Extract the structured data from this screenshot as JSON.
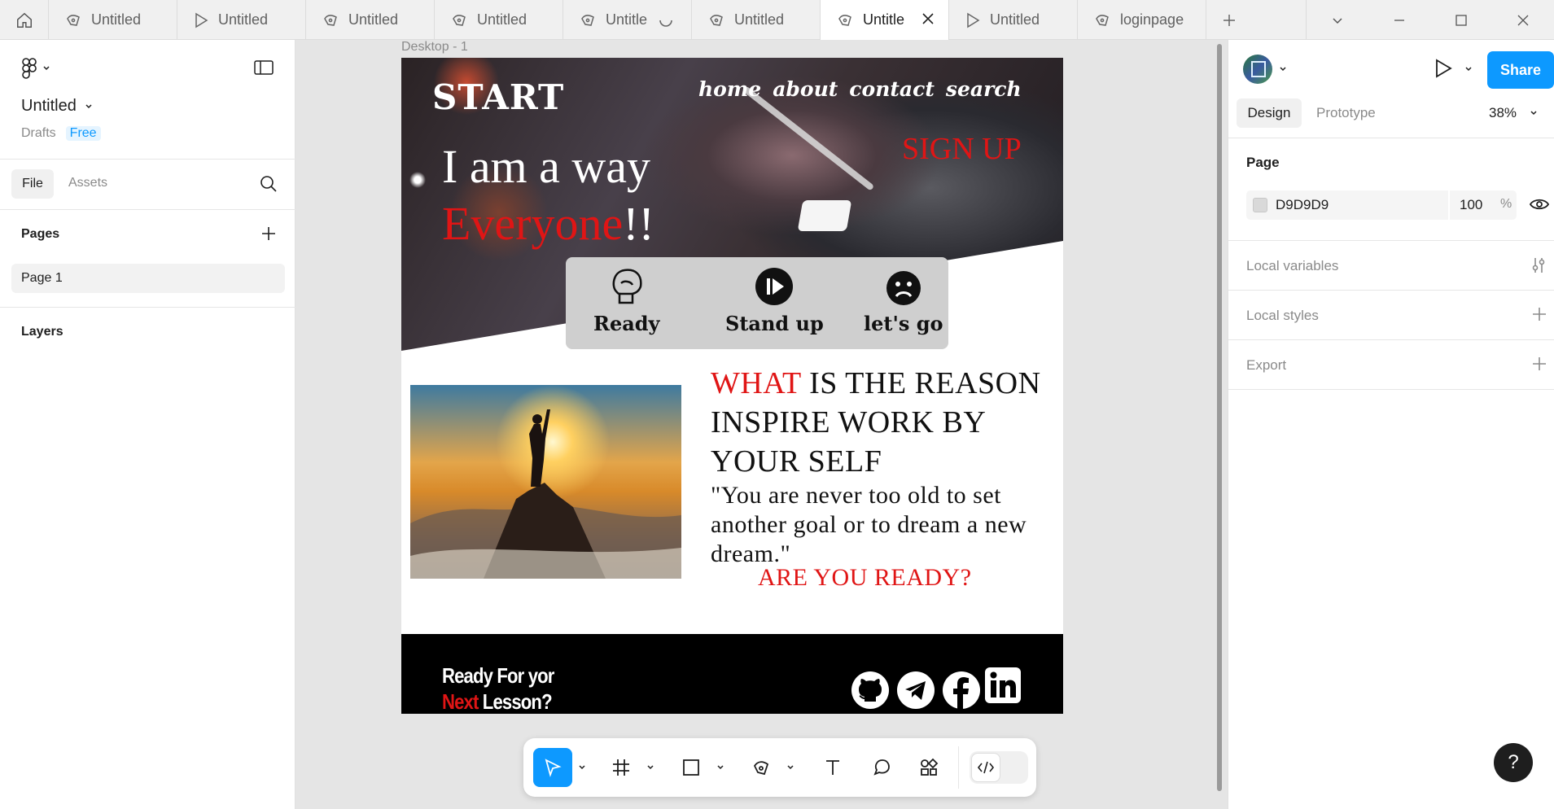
{
  "tabs": [
    {
      "label": "Untitled",
      "icon": "pen-icon",
      "active": false
    },
    {
      "label": "Untitled",
      "icon": "play-icon",
      "active": false
    },
    {
      "label": "Untitled",
      "icon": "pen-icon",
      "active": false
    },
    {
      "label": "Untitled",
      "icon": "pen-icon",
      "active": false
    },
    {
      "label": "Untitle",
      "icon": "pen-icon",
      "active": false,
      "loading": true
    },
    {
      "label": "Untitled",
      "icon": "pen-icon",
      "active": false
    },
    {
      "label": "Untitle",
      "icon": "pen-icon",
      "active": true
    },
    {
      "label": "Untitled",
      "icon": "play-icon",
      "active": false
    },
    {
      "label": "loginpage",
      "icon": "pen-icon",
      "active": false
    }
  ],
  "left": {
    "file_name": "Untitled",
    "drafts": "Drafts",
    "plan": "Free",
    "tab_file": "File",
    "tab_assets": "Assets",
    "pages_heading": "Pages",
    "page_item": "Page 1",
    "layers_heading": "Layers"
  },
  "canvas": {
    "frame_label": "Desktop - 1",
    "hero": {
      "logo": "START",
      "nav": [
        "home",
        "about",
        "contact",
        "search"
      ],
      "signup": "SIGN UP",
      "tagline_line1": "I am a way",
      "tagline_line2": "Everyone",
      "tagline_suffix": "!!",
      "actions": [
        {
          "label": "Ready",
          "icon": "boxing-glove-icon"
        },
        {
          "label": "Stand up",
          "icon": "play-circle-icon"
        },
        {
          "label": "let's go",
          "icon": "sad-face-icon"
        }
      ]
    },
    "headline_red": "WHAT",
    "headline_rest": " IS THE REASON INSPIRE WORK BY YOUR SELF",
    "quote": "\"You are never too old to set another goal or to dream a new dream.\"",
    "ready_question": "ARE YOU READY?",
    "footer": {
      "line1": "Ready For yor",
      "line2_red": "Next",
      "line2_rest": " Lesson?",
      "socials": [
        "github-icon",
        "telegram-icon",
        "facebook-icon",
        "linkedin-icon"
      ]
    }
  },
  "right": {
    "share_label": "Share",
    "tab_design": "Design",
    "tab_prototype": "Prototype",
    "zoom": "38%",
    "page_heading": "Page",
    "page_color": "D9D9D9",
    "page_opacity": "100",
    "percent_sign": "%",
    "local_variables": "Local variables",
    "local_styles": "Local styles",
    "export": "Export"
  },
  "help": "?",
  "colors": {
    "accent": "#0d99ff",
    "red_text": "#e01515",
    "page_bg": "#d9d9d9"
  }
}
